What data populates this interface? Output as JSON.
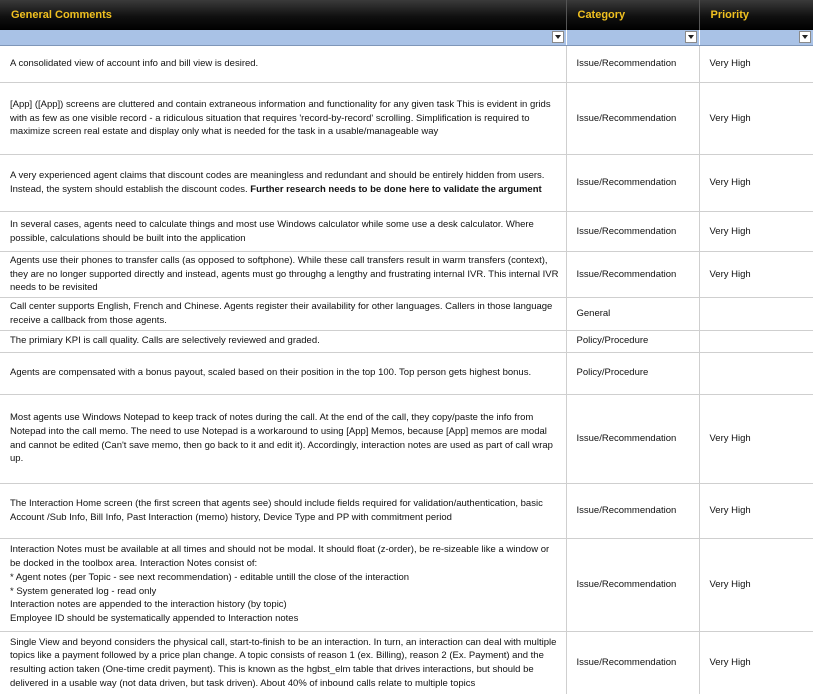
{
  "headers": {
    "comments": "General Comments",
    "category": "Category",
    "priority": "Priority"
  },
  "colors": {
    "header_bg": "#000000",
    "header_text": "#f0c020",
    "filter_row": "#a9c2e6"
  },
  "rows": [
    {
      "comment": "A consolidated view of account info and bill view is desired.",
      "category": "Issue/Recommendation",
      "priority": "Very High"
    },
    {
      "comment": "[App] ([App]) screens are cluttered and contain extraneous information and functionality for any given task This is evident in grids with as few as one visible record - a ridiculous situation that requires 'record-by-record' scrolling. Simplification is required to maximize screen real estate and display only what is needed for the task in a usable/manageable way",
      "category": "Issue/Recommendation",
      "priority": "Very High"
    },
    {
      "comment": "A very experienced agent claims that discount codes are meaningless and redundant and should be entirely hidden from users. Instead, the system should establish the discount codes. ",
      "comment_bold": "Further research needs to be done here to validate the argument",
      "category": "Issue/Recommendation",
      "priority": "Very High"
    },
    {
      "comment": "In several cases, agents need to calculate things and most use Windows calculator while some use a desk calculator. Where possible, calculations should be built into the application",
      "category": "Issue/Recommendation",
      "priority": "Very High"
    },
    {
      "comment": "Agents use their phones to transfer calls (as opposed to softphone). While these call transfers result in warm transfers (context), they are no longer supported directly and instead, agents must go throughg a lengthy and frustrating internal IVR. This internal IVR needs to be revisited",
      "category": "Issue/Recommendation",
      "priority": "Very High"
    },
    {
      "comment": "Call center supports English, French and Chinese. Agents register their availability for other languages. Callers in those language receive a callback from those agents.",
      "category": "General",
      "priority": ""
    },
    {
      "comment": "The primiary KPI is call quality. Calls are selectively reviewed and graded.",
      "category": "Policy/Procedure",
      "priority": ""
    },
    {
      "comment": "Agents are compensated with a bonus payout, scaled based on their position in the top 100. Top person gets highest bonus.",
      "category": "Policy/Procedure",
      "priority": ""
    },
    {
      "comment": "Most agents use Windows Notepad to keep track of notes during the call. At the end of the call, they copy/paste the info from Notepad into the call memo. The need to use Notepad is a workaround to using [App] Memos, because [App] memos are modal and cannot be edited (Can't save memo, then go back to it and edit it). Accordingly, interaction notes are used as part of call wrap up.",
      "category": "Issue/Recommendation",
      "priority": "Very High"
    },
    {
      "comment": "The Interaction Home screen (the first screen that agents see) should include fields required for validation/authentication, basic Account /Sub Info, Bill Info, Past Interaction (memo) history, Device Type and PP with commitment period",
      "category": "Issue/Recommendation",
      "priority": "Very High"
    },
    {
      "comment": "Interaction Notes must be available at all times and should not be modal. It should float (z-order), be re-sizeable like a window or be docked in the toolbox area. Interaction Notes consist of:\n* Agent  notes (per Topic - see next recommendation) - editable untill the close of the interaction\n* System generated log - read only\nInteraction notes are appended to the interaction history (by topic)\nEmployee ID should be systematically appended to Interaction notes",
      "category": "Issue/Recommendation",
      "priority": "Very High"
    },
    {
      "comment": "Single View and beyond considers the physical call, start-to-finish to be an interaction. In turn, an interaction can deal with multiple topics like a payment followed by a price plan change. A topic consists of reason 1 (ex. Billing), reason 2 (Ex. Payment) and the resulting action taken (One-time credit payment).  This is known as the hgbst_elm table that drives interactions, but should be delivered in a usable way (not data driven, but task driven). About 40% of inbound calls relate to multiple topics",
      "category": "Issue/Recommendation",
      "priority": "Very High"
    }
  ]
}
